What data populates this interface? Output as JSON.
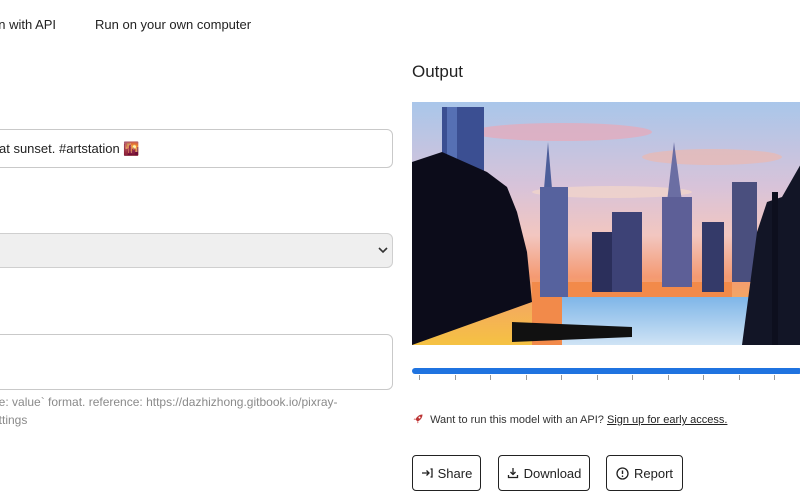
{
  "tabs": {
    "api": "un with API",
    "local": "Run on your own computer"
  },
  "form": {
    "prompt_value": "at sunset. #artstation 🌇",
    "select_value": "",
    "settings_value": "",
    "help_line1": "ne: value` format. reference: https://dazhizhong.gitbook.io/pixray-",
    "help_line2": "ettings"
  },
  "output": {
    "title": "Output",
    "progress_fraction": 1.0
  },
  "api_prompt": {
    "text": "Want to run this model with an API?",
    "link": "Sign up for early access."
  },
  "actions": {
    "share": "Share",
    "download": "Download",
    "report": "Report"
  },
  "icons": {
    "rocket": "rocket-icon",
    "share": "share-arrow-icon",
    "download": "download-icon",
    "report": "alert-circle-icon",
    "select": "chevron-down-icon"
  },
  "colors": {
    "progress": "#1f73e0",
    "button_border": "#222222"
  }
}
